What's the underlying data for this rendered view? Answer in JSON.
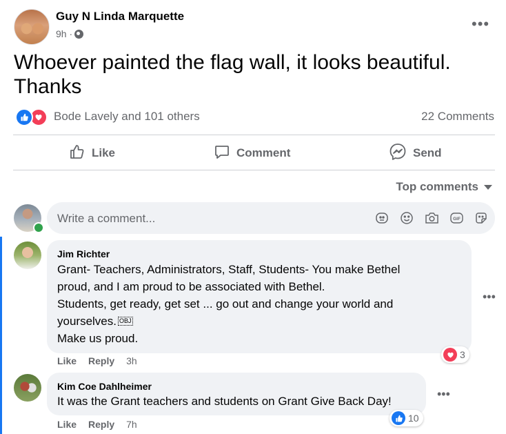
{
  "post": {
    "author": "Guy N Linda Marquette",
    "time": "9h ·",
    "text": "Whoever painted the flag wall, it looks beautiful. Thanks",
    "reactions_text": "Bode Lavely and 101 others",
    "comments_count": "22 Comments"
  },
  "actions": {
    "like": "Like",
    "comment": "Comment",
    "send": "Send"
  },
  "sort": {
    "label": "Top comments"
  },
  "composer": {
    "placeholder": "Write a comment..."
  },
  "comments": [
    {
      "author": "Jim Richter",
      "line1": "Grant- Teachers, Administrators, Staff, Students- You make Bethel",
      "line2": "proud, and I am proud to be associated with Bethel.",
      "line3": "Students, get ready, get set ... go out and change your world and",
      "line4": "yourselves.",
      "obj": "OBJ",
      "line5": "Make us proud.",
      "like": "Like",
      "reply": "Reply",
      "time": "3h",
      "reaction_count": "3",
      "reaction": "love"
    },
    {
      "author": "Kim Coe Dahlheimer",
      "line1": "It was the Grant teachers and students on Grant Give Back Day!",
      "like": "Like",
      "reply": "Reply",
      "time": "7h",
      "reaction_count": "10",
      "reaction": "like"
    }
  ],
  "colors": {
    "facebook_blue": "#1877f2",
    "love_red": "#f33e58",
    "secondary_text": "#65676b",
    "bubble_bg": "#f0f2f5",
    "online_green": "#31a24c"
  }
}
